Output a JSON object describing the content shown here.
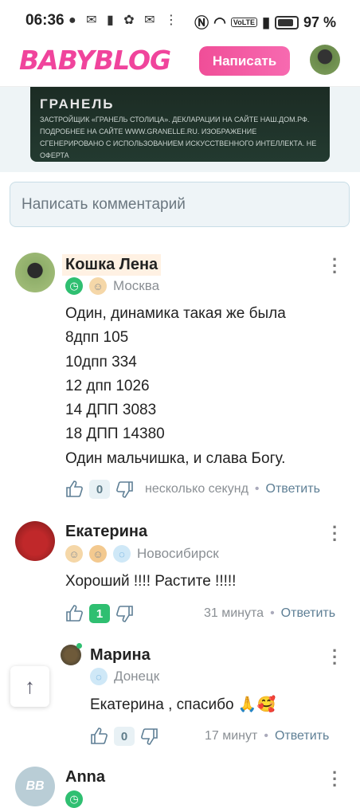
{
  "statusbar": {
    "time": "06:36",
    "battery": "97 %",
    "volte": "VoLTE"
  },
  "header": {
    "logo": "BABYBLOG",
    "write_button": "Написать"
  },
  "ad": {
    "title": "ГРАНЕЛЬ",
    "text": "ЗАСТРОЙЩИК «ГРАНЕЛЬ СТОЛИЦА». ДЕКЛАРАЦИИ НА САЙТЕ НАШ.ДОМ.РФ. ПОДРОБНЕЕ НА САЙТЕ WWW.GRANELLE.RU. ИЗОБРАЖЕНИЕ СГЕНЕРИРОВАНО С ИСПОЛЬЗОВАНИЕМ ИСКУССТВЕННОГО ИНТЕЛЛЕКТА. НЕ ОФЕРТА"
  },
  "comment_input": {
    "placeholder": "Написать комментарий"
  },
  "comments": [
    {
      "author": "Кошка Лена",
      "city": "Москва",
      "text": "Один, динамика такая же была\n8дпп 105\n10дпп 334\n12 дпп 1026\n14 ДПП 3083\n18 ДПП 14380\nОдин мальчишка, и слава Богу.",
      "likes": "0",
      "time": "несколько секунд",
      "reply": "Ответить"
    },
    {
      "author": "Екатерина",
      "city": "Новосибирск",
      "text": "Хороший !!!! Растите !!!!!",
      "likes": "1",
      "time": "31 минута",
      "reply": "Ответить"
    },
    {
      "author": "Марина",
      "city": "Донецк",
      "text": "Екатерина , спасибо 🙏🥰",
      "likes": "0",
      "time": "17 минут",
      "reply": "Ответить"
    },
    {
      "author": "Anna",
      "avatar_initials": "BB"
    }
  ],
  "colors": {
    "brand": "#f0449c",
    "link": "#5e7f95",
    "like_positive": "#2fbf71"
  }
}
